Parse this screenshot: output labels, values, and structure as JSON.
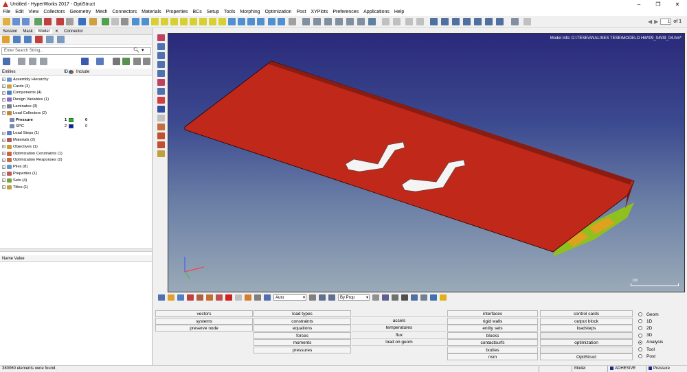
{
  "window": {
    "title": "Untitled - HyperWorks 2017 - OptiStruct",
    "minimize": "–",
    "maximize": "❐",
    "close": "✕"
  },
  "menu": [
    "File",
    "Edit",
    "View",
    "Collectors",
    "Geometry",
    "Mesh",
    "Connectors",
    "Materials",
    "Properties",
    "BCs",
    "Setup",
    "Tools",
    "Morphing",
    "Optimization",
    "Post",
    "XYPlots",
    "Preferences",
    "Applications",
    "Help"
  ],
  "pager": {
    "value": "1",
    "total": "of 1"
  },
  "browser_tabs": [
    "Session",
    "Mask",
    "Model",
    "Connector"
  ],
  "active_tab": "Model",
  "search": {
    "placeholder": "Enter Search String..."
  },
  "entity_header": {
    "entities": "Entities",
    "id": "ID",
    "include": "Include"
  },
  "tree": [
    {
      "label": "Assembly Hierarchy",
      "icon": "#6a8fcf"
    },
    {
      "label": "Cards (3)",
      "icon": "#c9a34a"
    },
    {
      "label": "Components (4)",
      "icon": "#4a7fd0"
    },
    {
      "label": "Design Variables (1)",
      "icon": "#8a6ac0"
    },
    {
      "label": "Laminates (3)",
      "icon": "#708090"
    },
    {
      "label": "Load Collectors (2)",
      "icon": "#c08a30"
    },
    {
      "label": "Load Steps (1)",
      "icon": "#5a80c8"
    },
    {
      "label": "Materials (2)",
      "icon": "#b05a5a"
    },
    {
      "label": "Objectives (1)",
      "icon": "#c8a030"
    },
    {
      "label": "Optimization Constraints (1)",
      "icon": "#d06040"
    },
    {
      "label": "Optimization Responses (2)",
      "icon": "#c07040"
    },
    {
      "label": "Plies (8)",
      "icon": "#5a9ad0"
    },
    {
      "label": "Properties (1)",
      "icon": "#c05a5a"
    },
    {
      "label": "Sets (4)",
      "icon": "#7aa040"
    },
    {
      "label": "Titles (1)",
      "icon": "#c0a040"
    }
  ],
  "load_collectors": [
    {
      "label": "Pressure",
      "id": "1",
      "color": "#00d000",
      "include": "0"
    },
    {
      "label": "SPC",
      "id": "2",
      "color": "#0020c0",
      "include": "0"
    }
  ],
  "name_value_header": "Name Value",
  "viewport": {
    "model_info": "Model Info: D:\\TESE\\ANALISES TESE\\MODELO HW\\09_04\\09_04.hm*",
    "scale_label": "100",
    "colors": {
      "skin": "#c0281a",
      "skin_dark": "#8a1c12",
      "rib": "#e0a020",
      "spar": "#90c020"
    }
  },
  "viewbar": {
    "auto": "Auto",
    "by_prop": "By Prop"
  },
  "panel": {
    "col1": [
      "vectors",
      "systems",
      "preserve node"
    ],
    "col2": [
      "load types",
      "constraints",
      "equations",
      "forces",
      "moments",
      "pressures"
    ],
    "col3": [
      "accels",
      "temperatures",
      "flux",
      "load on geom"
    ],
    "col4": [
      "interfaces",
      "rigid walls",
      "entity sets",
      "blocks",
      "contactsurfs",
      "bodies",
      "nsm"
    ],
    "col5": [
      "control cards",
      "output block",
      "loadsteps",
      "optimization",
      "OptiStruct"
    ]
  },
  "radios": [
    "Geom",
    "1D",
    "2D",
    "3D",
    "Analysis",
    "Tool",
    "Post"
  ],
  "selected_radio": "Analysis",
  "status": {
    "message": "380060 elements were found.",
    "model": "Model",
    "adhesive": "ADHESIVE",
    "adhesive_color": "#1a2a8a",
    "pressure": "Pressure",
    "pressure_color": "#1a2a8a"
  }
}
